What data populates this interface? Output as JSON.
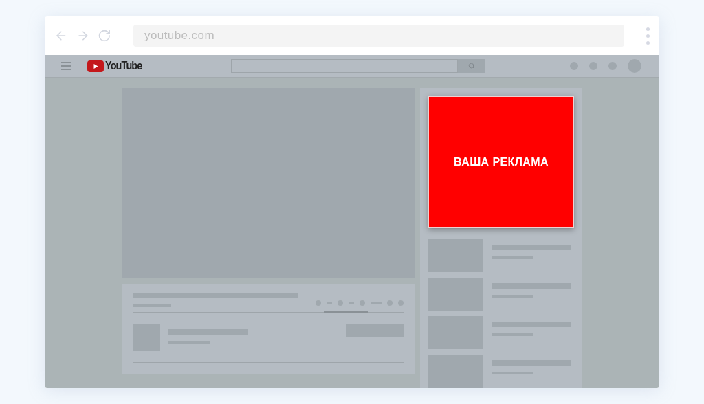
{
  "browser": {
    "url": "youtube.com"
  },
  "site": {
    "logo": "YouTube"
  },
  "ad": {
    "label": "ВАША РЕКЛАМА"
  }
}
